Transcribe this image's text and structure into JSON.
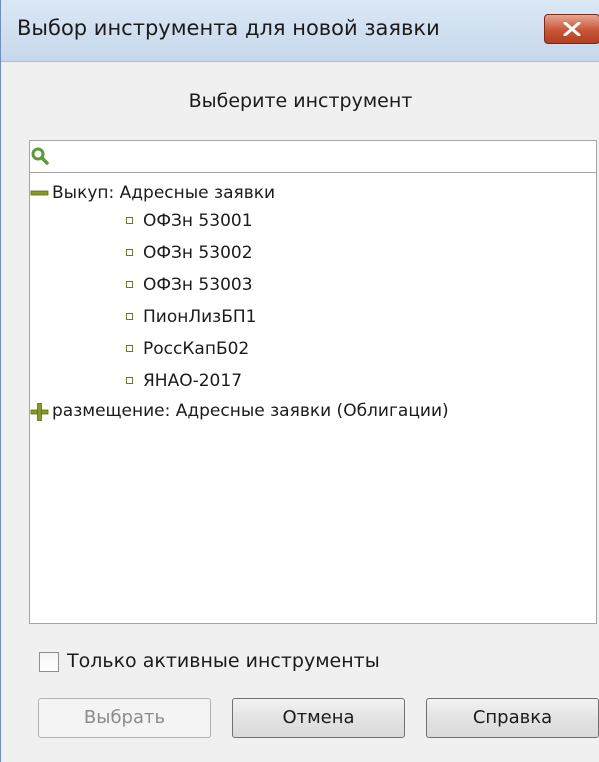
{
  "window": {
    "title": "Выбор инструмента для новой заявки"
  },
  "prompt": "Выберите инструмент",
  "search": {
    "value": "",
    "placeholder": ""
  },
  "tree": {
    "groups": [
      {
        "label": "Выкуп: Адресные заявки",
        "expanded": true,
        "items": [
          "ОФЗн 53001",
          "ОФЗн 53002",
          "ОФЗн 53003",
          "ПионЛизБП1",
          "РоссКапБ02",
          "ЯНАО-2017"
        ]
      },
      {
        "label": "размещение: Адресные заявки (Облигации)",
        "expanded": false,
        "items": []
      }
    ]
  },
  "options": {
    "only_active_label": "Только активные инструменты",
    "only_active_checked": false
  },
  "buttons": {
    "select": "Выбрать",
    "cancel": "Отмена",
    "help": "Справка"
  },
  "colors": {
    "titlebar": "#c6d8ec",
    "close_button": "#c75638",
    "tree_icon": "#8a9a2a",
    "search_icon": "#5a9a3a"
  },
  "icons": {
    "close": "close-icon",
    "search": "search-icon",
    "collapse": "minus-icon",
    "expand": "plus-icon",
    "leaf": "square-bullet-icon"
  }
}
